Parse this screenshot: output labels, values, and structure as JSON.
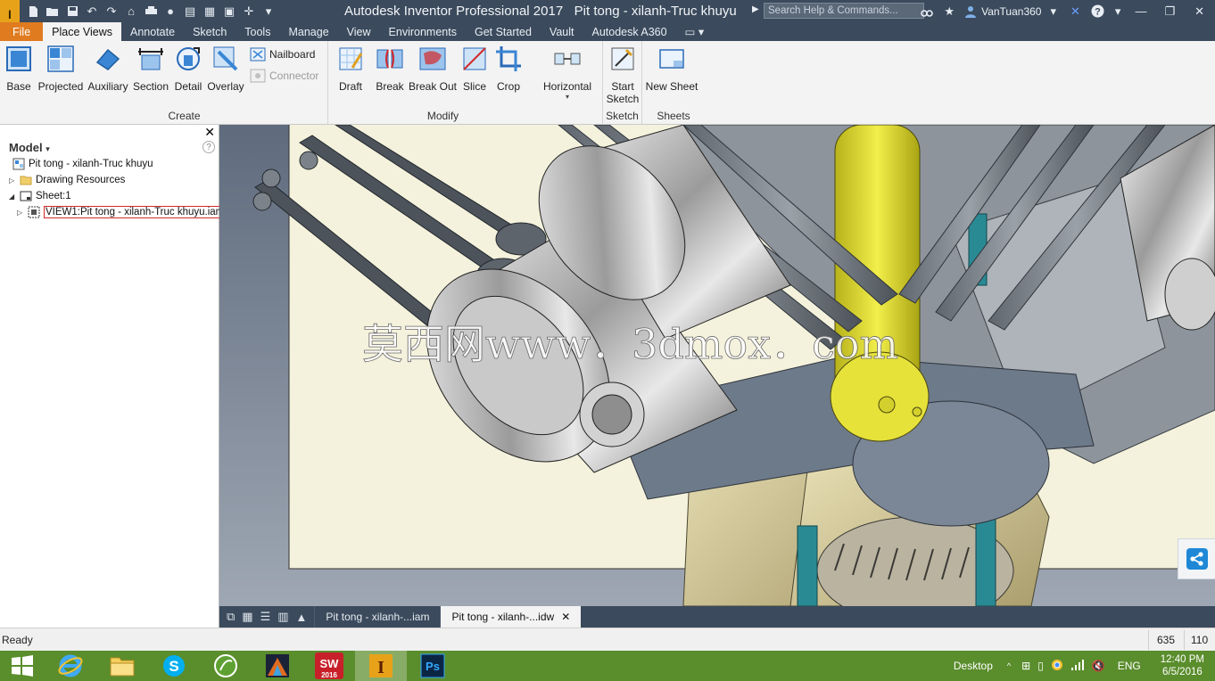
{
  "app": {
    "title": "Autodesk Inventor Professional 2017",
    "document_title": "Pit tong - xilanh-Truc khuyu",
    "logo_text": "I",
    "search_placeholder": "Search Help & Commands...",
    "user": "VanTuan360"
  },
  "tabs": [
    {
      "label": "File"
    },
    {
      "label": "Place Views"
    },
    {
      "label": "Annotate"
    },
    {
      "label": "Sketch"
    },
    {
      "label": "Tools"
    },
    {
      "label": "Manage"
    },
    {
      "label": "View"
    },
    {
      "label": "Environments"
    },
    {
      "label": "Get Started"
    },
    {
      "label": "Vault"
    },
    {
      "label": "Autodesk A360"
    }
  ],
  "ribbon": {
    "create": {
      "label": "Create",
      "buttons": [
        {
          "label": "Base"
        },
        {
          "label": "Projected"
        },
        {
          "label": "Auxiliary"
        },
        {
          "label": "Section"
        },
        {
          "label": "Detail"
        },
        {
          "label": "Overlay"
        }
      ],
      "nailboard": "Nailboard",
      "connector": "Connector"
    },
    "modify": {
      "label": "Modify",
      "buttons": [
        {
          "label": "Draft"
        },
        {
          "label": "Break"
        },
        {
          "label": "Break Out"
        },
        {
          "label": "Slice"
        },
        {
          "label": "Crop"
        },
        {
          "label": "Horizontal"
        }
      ]
    },
    "sketch": {
      "label": "Sketch",
      "button": "Start Sketch"
    },
    "sheets": {
      "label": "Sheets",
      "button": "New Sheet"
    }
  },
  "browser": {
    "header": "Model",
    "items": [
      {
        "label": "Pit tong - xilanh-Truc khuyu"
      },
      {
        "label": "Drawing Resources"
      },
      {
        "label": "Sheet:1"
      },
      {
        "label": "VIEW1:Pit tong - xilanh-Truc khuyu.iam"
      }
    ]
  },
  "canvas": {
    "watermark": "莫西网www．3dmox．com"
  },
  "doc_tabs": [
    {
      "label": "Pit tong - xilanh-...iam"
    },
    {
      "label": "Pit tong - xilanh-...idw"
    }
  ],
  "status": {
    "text": "Ready",
    "coord_a": "635",
    "coord_b": "110"
  },
  "taskbar": {
    "desktop_label": "Desktop",
    "language": "ENG",
    "time": "12:40 PM",
    "date": "6/5/2016",
    "solidworks_label": "2016"
  },
  "colors": {
    "titlebar": "#3b4a5c",
    "file_tab": "#e07b1f",
    "taskbar": "#5a8d2c",
    "sheet": "#f4f2dc",
    "part_gray": "#8d949c",
    "part_yellow": "#e6e23a",
    "part_tan": "#d8cfa0",
    "part_teal": "#2a8a94"
  }
}
